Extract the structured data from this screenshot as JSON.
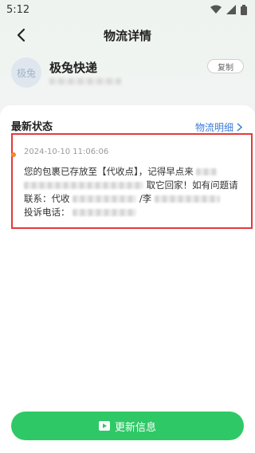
{
  "status_bar": {
    "time": "5:12"
  },
  "nav": {
    "title": "物流详情"
  },
  "courier": {
    "logo_text": "极兔",
    "name": "极兔快递",
    "copy_label": "复制"
  },
  "latest": {
    "title": "最新状态",
    "detail_link": "物流明细",
    "timestamp": "2024-10-10 11:06:06",
    "line1_prefix": "您的包裹已存放至【代收点】，记得早点来",
    "line2_text": "取它回家！如有问题请",
    "line3_prefix": "联系：代收",
    "line3_mid": "/李",
    "line4_prefix": "投诉电话："
  },
  "footer": {
    "refresh_label": "更新信息"
  },
  "colors": {
    "accent_green": "#2fc866",
    "link_blue": "#3b7bd8",
    "highlight_red": "#e53a3a"
  }
}
